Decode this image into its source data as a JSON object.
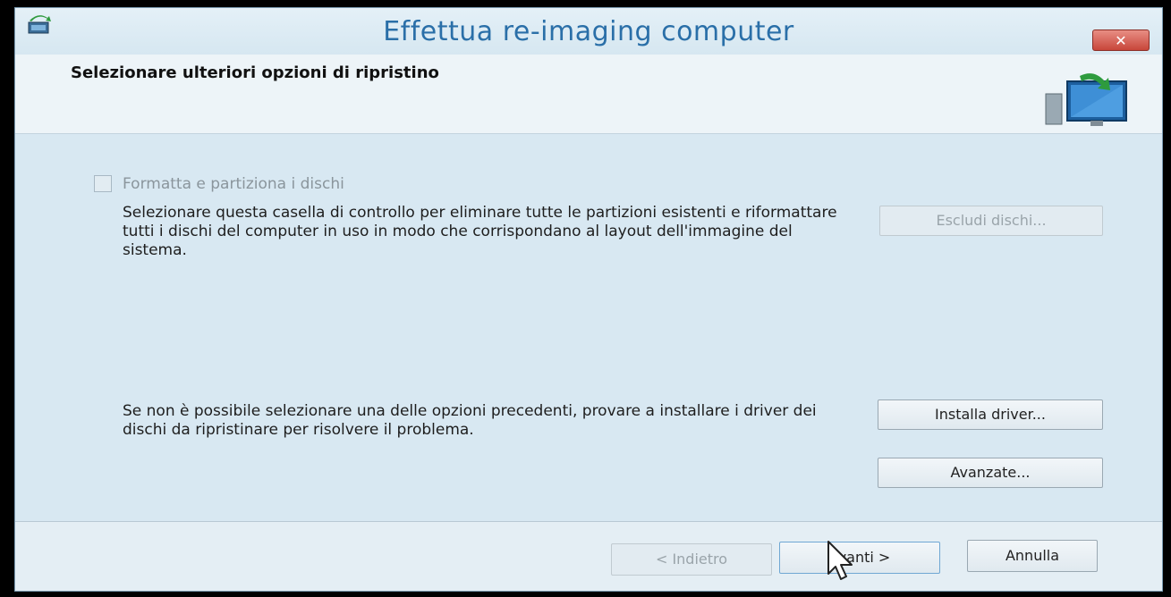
{
  "window": {
    "title": "Effettua re-imaging computer",
    "close_label": "✕"
  },
  "header": {
    "heading": "Selezionare ulteriori opzioni di ripristino"
  },
  "format_option": {
    "checkbox_label": "Formatta e partiziona i dischi",
    "checked": false,
    "description": "Selezionare questa casella di controllo per eliminare tutte le partizioni esistenti e riformattare tutti i dischi del computer in uso in modo che corrispondano al layout dell'immagine del sistema.",
    "exclude_button": "Escludi dischi..."
  },
  "driver_section": {
    "description": "Se non è possibile selezionare una delle opzioni precedenti, provare a installare i driver dei dischi da ripristinare per risolvere il problema.",
    "install_button": "Installa driver...",
    "advanced_button": "Avanzate..."
  },
  "footer": {
    "back_button": "< Indietro",
    "next_button": "Avanti >",
    "cancel_button": "Annulla"
  },
  "colors": {
    "title_text": "#2a6fa8",
    "window_bg": "#d8e8f2",
    "close_button": "#c8463a"
  },
  "icons": {
    "app": "restore-app-icon",
    "header": "monitor-restore-icon",
    "cursor": "mouse-cursor-icon"
  }
}
